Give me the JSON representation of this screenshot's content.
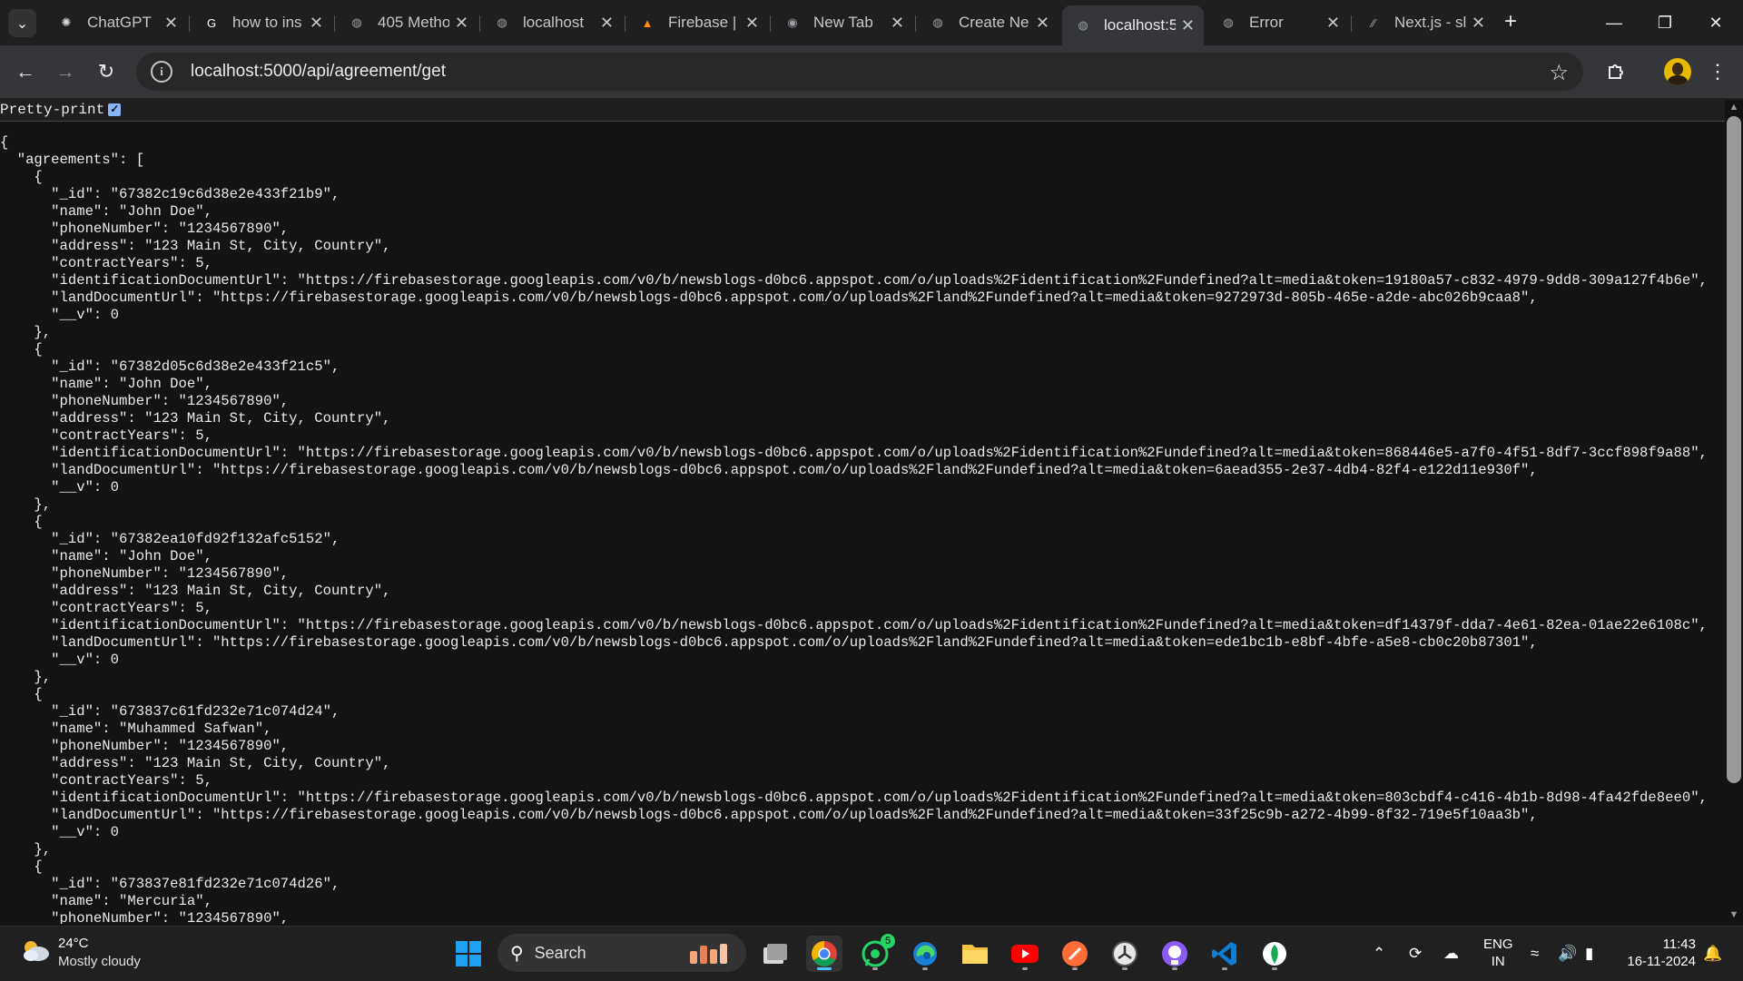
{
  "tabs": [
    {
      "title": "ChatGPT",
      "icon": "chatgpt-icon",
      "active": false
    },
    {
      "title": "how to ins",
      "icon": "google-icon",
      "active": false
    },
    {
      "title": "405 Metho",
      "icon": "globe-icon",
      "active": false
    },
    {
      "title": "localhost",
      "icon": "globe-icon",
      "active": false
    },
    {
      "title": "Firebase | (",
      "icon": "firebase-icon",
      "active": false
    },
    {
      "title": "New Tab",
      "icon": "chrome-icon",
      "active": false
    },
    {
      "title": "Create Ne",
      "icon": "globe-icon",
      "active": false
    },
    {
      "title": "localhost:5",
      "icon": "globe-icon",
      "active": true
    },
    {
      "title": "Error",
      "icon": "globe-icon",
      "active": false
    },
    {
      "title": "Next.js - sl",
      "icon": "nextjs-icon",
      "active": false
    }
  ],
  "omnibox": {
    "url": "localhost:5000/api/agreement/get"
  },
  "page": {
    "pretty_print_label": "Pretty-print",
    "pretty_print_checked": true,
    "json_lines": [
      "{",
      "  \"agreements\": [",
      "    {",
      "      \"_id\": \"67382c19c6d38e2e433f21b9\",",
      "      \"name\": \"John Doe\",",
      "      \"phoneNumber\": \"1234567890\",",
      "      \"address\": \"123 Main St, City, Country\",",
      "      \"contractYears\": 5,",
      "      \"identificationDocumentUrl\": \"https://firebasestorage.googleapis.com/v0/b/newsblogs-d0bc6.appspot.com/o/uploads%2Fidentification%2Fundefined?alt=media&token=19180a57-c832-4979-9dd8-309a127f4b6e\",",
      "      \"landDocumentUrl\": \"https://firebasestorage.googleapis.com/v0/b/newsblogs-d0bc6.appspot.com/o/uploads%2Fland%2Fundefined?alt=media&token=9272973d-805b-465e-a2de-abc026b9caa8\",",
      "      \"__v\": 0",
      "    },",
      "    {",
      "      \"_id\": \"67382d05c6d38e2e433f21c5\",",
      "      \"name\": \"John Doe\",",
      "      \"phoneNumber\": \"1234567890\",",
      "      \"address\": \"123 Main St, City, Country\",",
      "      \"contractYears\": 5,",
      "      \"identificationDocumentUrl\": \"https://firebasestorage.googleapis.com/v0/b/newsblogs-d0bc6.appspot.com/o/uploads%2Fidentification%2Fundefined?alt=media&token=868446e5-a7f0-4f51-8df7-3ccf898f9a88\",",
      "      \"landDocumentUrl\": \"https://firebasestorage.googleapis.com/v0/b/newsblogs-d0bc6.appspot.com/o/uploads%2Fland%2Fundefined?alt=media&token=6aead355-2e37-4db4-82f4-e122d11e930f\",",
      "      \"__v\": 0",
      "    },",
      "    {",
      "      \"_id\": \"67382ea10fd92f132afc5152\",",
      "      \"name\": \"John Doe\",",
      "      \"phoneNumber\": \"1234567890\",",
      "      \"address\": \"123 Main St, City, Country\",",
      "      \"contractYears\": 5,",
      "      \"identificationDocumentUrl\": \"https://firebasestorage.googleapis.com/v0/b/newsblogs-d0bc6.appspot.com/o/uploads%2Fidentification%2Fundefined?alt=media&token=df14379f-dda7-4e61-82ea-01ae22e6108c\",",
      "      \"landDocumentUrl\": \"https://firebasestorage.googleapis.com/v0/b/newsblogs-d0bc6.appspot.com/o/uploads%2Fland%2Fundefined?alt=media&token=ede1bc1b-e8bf-4bfe-a5e8-cb0c20b87301\",",
      "      \"__v\": 0",
      "    },",
      "    {",
      "      \"_id\": \"673837c61fd232e71c074d24\",",
      "      \"name\": \"Muhammed Safwan\",",
      "      \"phoneNumber\": \"1234567890\",",
      "      \"address\": \"123 Main St, City, Country\",",
      "      \"contractYears\": 5,",
      "      \"identificationDocumentUrl\": \"https://firebasestorage.googleapis.com/v0/b/newsblogs-d0bc6.appspot.com/o/uploads%2Fidentification%2Fundefined?alt=media&token=803cbdf4-c416-4b1b-8d98-4fa42fde8ee0\",",
      "      \"landDocumentUrl\": \"https://firebasestorage.googleapis.com/v0/b/newsblogs-d0bc6.appspot.com/o/uploads%2Fland%2Fundefined?alt=media&token=33f25c9b-a272-4b99-8f32-719e5f10aa3b\",",
      "      \"__v\": 0",
      "    },",
      "    {",
      "      \"_id\": \"673837e81fd232e71c074d26\",",
      "      \"name\": \"Mercuria\",",
      "      \"phoneNumber\": \"1234567890\","
    ]
  },
  "taskbar": {
    "weather": {
      "temp": "24°C",
      "desc": "Mostly cloudy"
    },
    "search_label": "Search",
    "apps": [
      {
        "name": "start-button",
        "icon": "windows-icon"
      },
      {
        "name": "task-view",
        "icon": "task-view-icon"
      },
      {
        "name": "chrome",
        "icon": "chrome-icon",
        "active": true
      },
      {
        "name": "whatsapp",
        "icon": "whatsapp-icon",
        "badge": "5"
      },
      {
        "name": "edge",
        "icon": "edge-icon"
      },
      {
        "name": "file-explorer",
        "icon": "folder-icon"
      },
      {
        "name": "youtube",
        "icon": "youtube-icon"
      },
      {
        "name": "postman",
        "icon": "postman-icon"
      },
      {
        "name": "clock-app",
        "icon": "clock-icon"
      },
      {
        "name": "github",
        "icon": "github-icon"
      },
      {
        "name": "vscode",
        "icon": "vscode-icon"
      },
      {
        "name": "mongodb",
        "icon": "mongodb-icon"
      }
    ],
    "lang": {
      "line1": "ENG",
      "line2": "IN"
    },
    "clock": {
      "time": "11:43",
      "date": "16-11-2024"
    }
  },
  "colors": {
    "accent": "#8ab4f8",
    "page_bg": "#131313",
    "chrome_bg": "#35363a"
  }
}
